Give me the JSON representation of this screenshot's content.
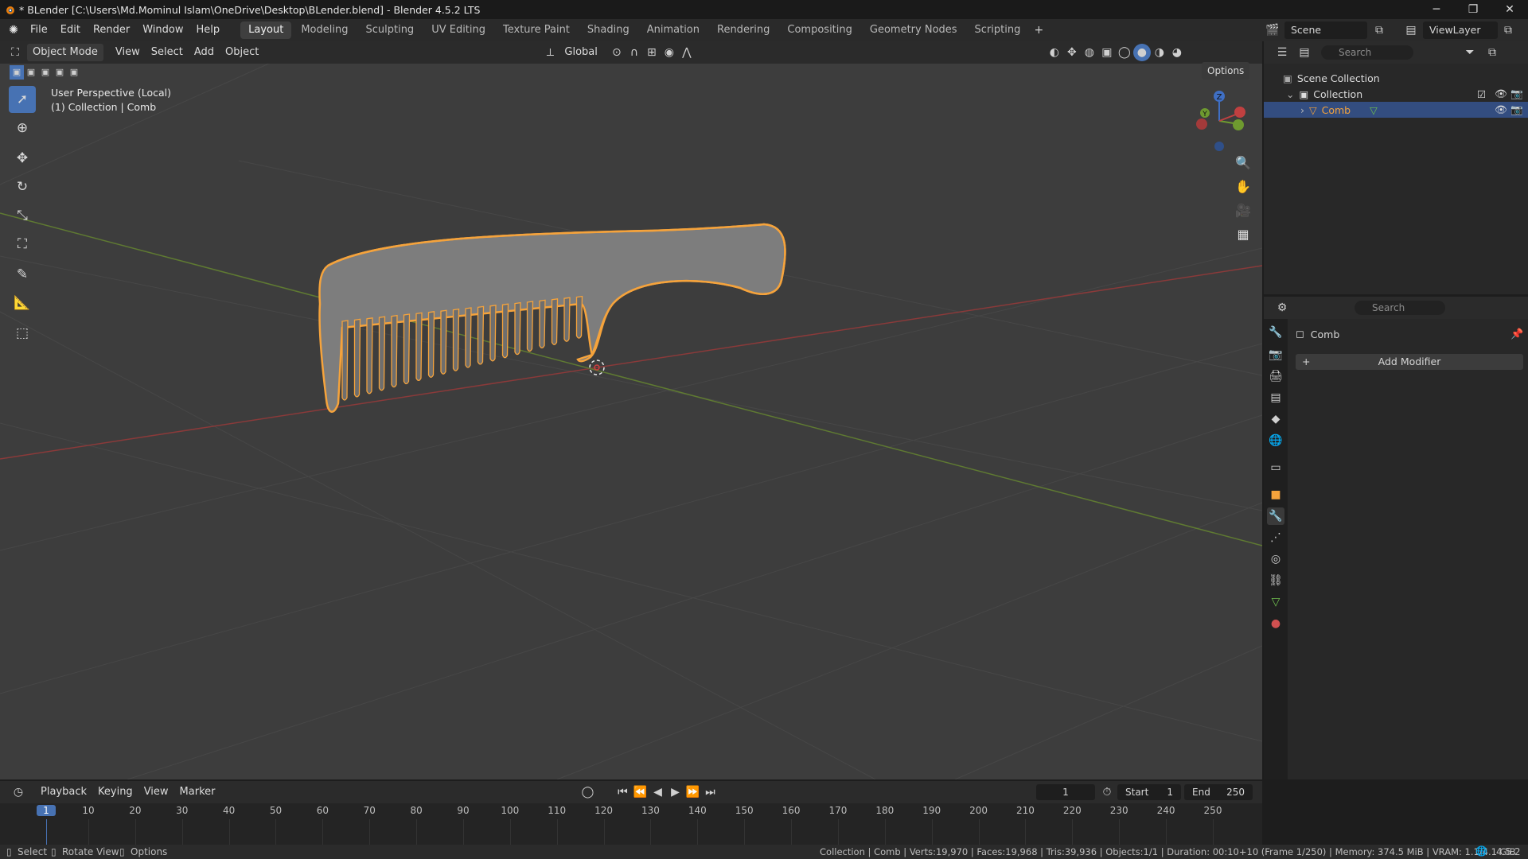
{
  "window": {
    "title": "* BLender [C:\\Users\\Md.Mominul Islam\\OneDrive\\Desktop\\BLender.blend] - Blender 4.5.2 LTS",
    "minimize": "─",
    "maximize": "❐",
    "close": "✕"
  },
  "menu": [
    "File",
    "Edit",
    "Render",
    "Window",
    "Help"
  ],
  "workspaces": [
    "Layout",
    "Modeling",
    "Sculpting",
    "UV Editing",
    "Texture Paint",
    "Shading",
    "Animation",
    "Rendering",
    "Compositing",
    "Geometry Nodes",
    "Scripting"
  ],
  "active_workspace": "Layout",
  "top_right": {
    "scene": "Scene",
    "view_layer": "ViewLayer"
  },
  "viewport": {
    "mode": "Object Mode",
    "menus": [
      "View",
      "Select",
      "Add",
      "Object"
    ],
    "orientation": "Global",
    "options": "Options",
    "perspective": "User Perspective (Local)",
    "context": "(1) Collection | Comb",
    "gizmo_z": "Z",
    "gizmo_y": "Y",
    "gizmo_x": "X"
  },
  "outliner": {
    "search_placeholder": "Search",
    "scene_collection": "Scene Collection",
    "collection": "Collection",
    "object": "Comb"
  },
  "properties": {
    "search_placeholder": "Search",
    "object_name": "Comb",
    "add_modifier": "Add Modifier"
  },
  "timeline": {
    "menus": [
      "Playback",
      "Keying",
      "View",
      "Marker"
    ],
    "current_frame": "1",
    "start_label": "Start",
    "start": "1",
    "end_label": "End",
    "end": "250",
    "ticks": [
      "1",
      "10",
      "20",
      "30",
      "40",
      "50",
      "60",
      "70",
      "80",
      "90",
      "100",
      "110",
      "120",
      "130",
      "140",
      "150",
      "160",
      "170",
      "180",
      "190",
      "200",
      "210",
      "220",
      "230",
      "240",
      "250"
    ]
  },
  "statusbar": {
    "left": [
      "Select",
      "Rotate View",
      "Options"
    ],
    "right": "Collection | Comb | Verts:19,970 | Faces:19,968 | Tris:39,936 | Objects:1/1 | Duration: 00:10+10 (Frame 1/250) | Memory: 374.5 MiB | VRAM: 1.1/4.1 GiB",
    "version": "4.5.2"
  },
  "colors": {
    "accent": "#4772b3",
    "selection_outline": "#f5a33c",
    "x_axis": "#b03a3a",
    "y_axis": "#6e9a2f"
  }
}
